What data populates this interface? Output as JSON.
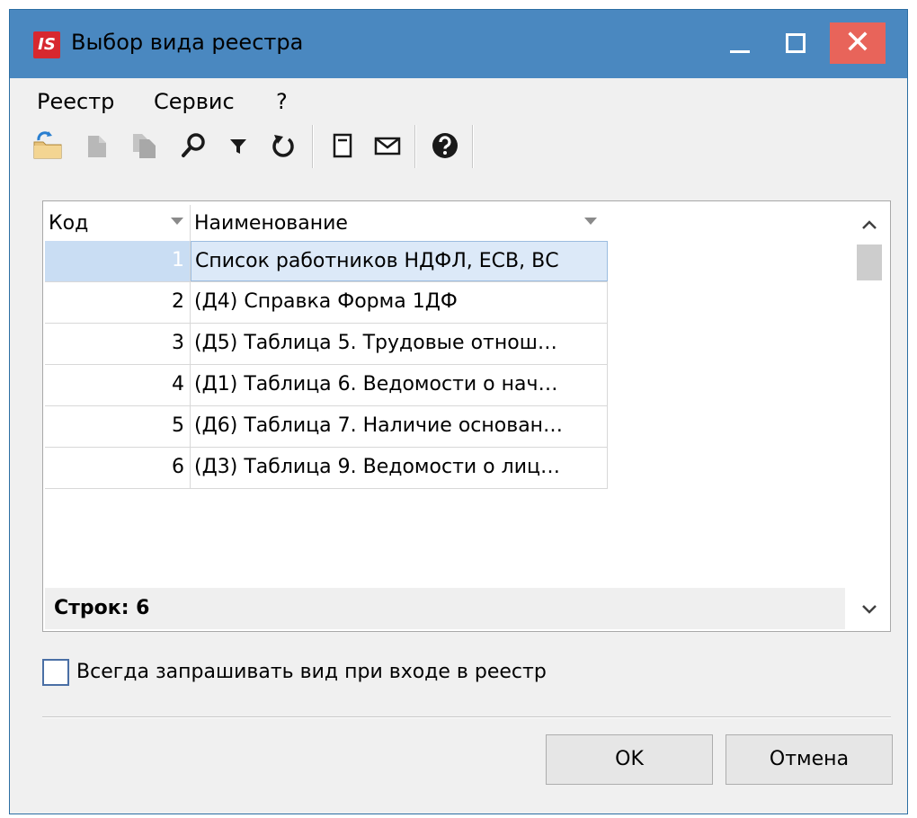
{
  "window": {
    "logo_text": "IS",
    "title": "Выбор вида реестра",
    "close_glyph": "✕"
  },
  "menu": {
    "items": [
      "Реестр",
      "Сервис",
      "?"
    ]
  },
  "toolbar": {
    "icons": [
      "refresh-folder-icon",
      "copy-icon",
      "copy-multiple-icon",
      "search-icon",
      "filter-icon",
      "undo-icon",
      "document-icon",
      "mail-icon",
      "help-icon"
    ]
  },
  "grid": {
    "columns": [
      "Код",
      "Наименование"
    ],
    "rows": [
      {
        "code": "1",
        "name": "Список работников НДФЛ, ЕСВ, ВС",
        "selected": true
      },
      {
        "code": "2",
        "name": "(Д4) Справка Форма 1ДФ"
      },
      {
        "code": "3",
        "name": "(Д5) Таблица 5. Трудовые отнош…"
      },
      {
        "code": "4",
        "name": "(Д1) Таблица 6. Ведомости о нач…"
      },
      {
        "code": "5",
        "name": "(Д6) Таблица 7. Наличие основан…"
      },
      {
        "code": "6",
        "name": "(Д3) Таблица 9. Ведомости о лиц…"
      }
    ],
    "footer": "Строк: 6"
  },
  "checkbox": {
    "label": "Всегда запрашивать вид при входе в реестр",
    "checked": false
  },
  "buttons": {
    "ok": "OK",
    "cancel": "Отмена"
  },
  "colors": {
    "titlebar": "#4a88c0",
    "close": "#e8645a",
    "logo": "#d7282f",
    "selection": "#dce9f8"
  }
}
